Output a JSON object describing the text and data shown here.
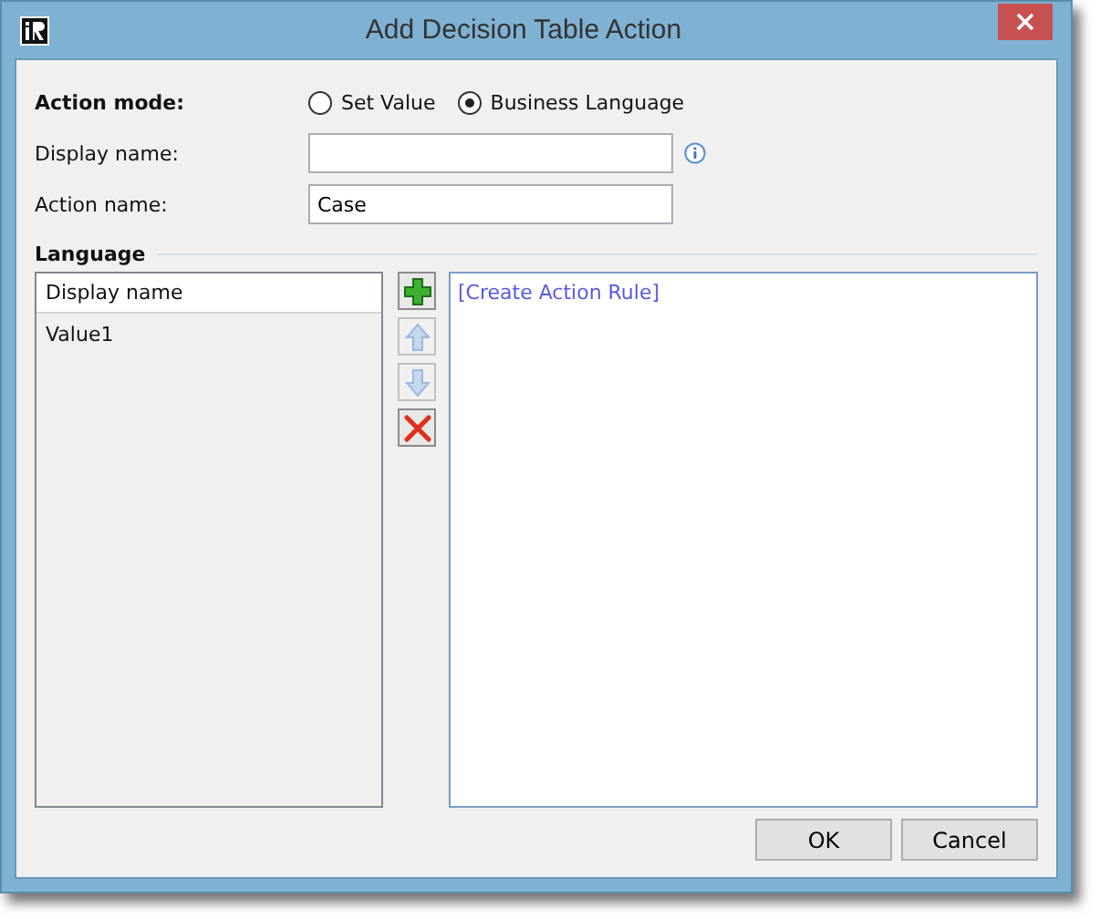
{
  "window": {
    "title": "Add Decision Table Action"
  },
  "action_mode": {
    "label": "Action mode:",
    "options": [
      {
        "label": "Set Value",
        "selected": false
      },
      {
        "label": "Business Language",
        "selected": true
      }
    ]
  },
  "display_name": {
    "label": "Display name:"
  },
  "action_name": {
    "label": "Action name:",
    "value": "Case"
  },
  "language": {
    "heading": "Language",
    "list": {
      "column": "Display name",
      "rows": [
        {
          "text": "Value1"
        }
      ]
    },
    "tools": [
      {
        "kind": "add",
        "disabled": false
      },
      {
        "kind": "up",
        "disabled": true
      },
      {
        "kind": "down",
        "disabled": true
      },
      {
        "kind": "delete",
        "disabled": false
      }
    ],
    "rule_link": "[Create Action Rule]"
  },
  "buttons": [
    {
      "label": "OK"
    },
    {
      "label": "Cancel"
    }
  ]
}
